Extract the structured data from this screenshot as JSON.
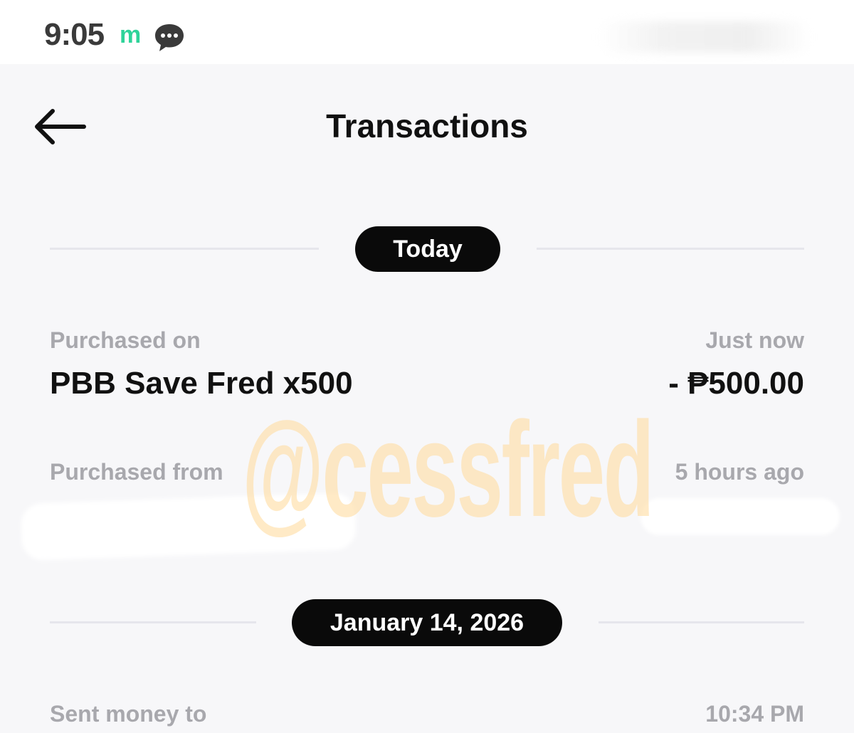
{
  "status_bar": {
    "time": "9:05",
    "app_icon_letter": "m",
    "icons": [
      "m-app-icon",
      "chat-bubble-icon"
    ]
  },
  "header": {
    "title": "Transactions",
    "back_icon": "back-arrow-icon"
  },
  "sections": [
    {
      "date_label": "Today",
      "transactions": [
        {
          "caption": "Purchased on",
          "name": "PBB Save Fred x500",
          "time": "Just now",
          "amount": "- ₱500.00"
        },
        {
          "caption": "Purchased from",
          "time": "5 hours ago"
        }
      ]
    },
    {
      "date_label": "January 14, 2026",
      "transactions": [
        {
          "caption": "Sent money to",
          "time": "10:34 PM"
        }
      ]
    }
  ],
  "watermark": "@cessfred",
  "colors": {
    "accent_green": "#2fd39a",
    "pill_bg": "#0a0a0a",
    "caption_gray": "#a8a8ad",
    "background": "#f7f7f9",
    "watermark": "#ffdca0"
  }
}
